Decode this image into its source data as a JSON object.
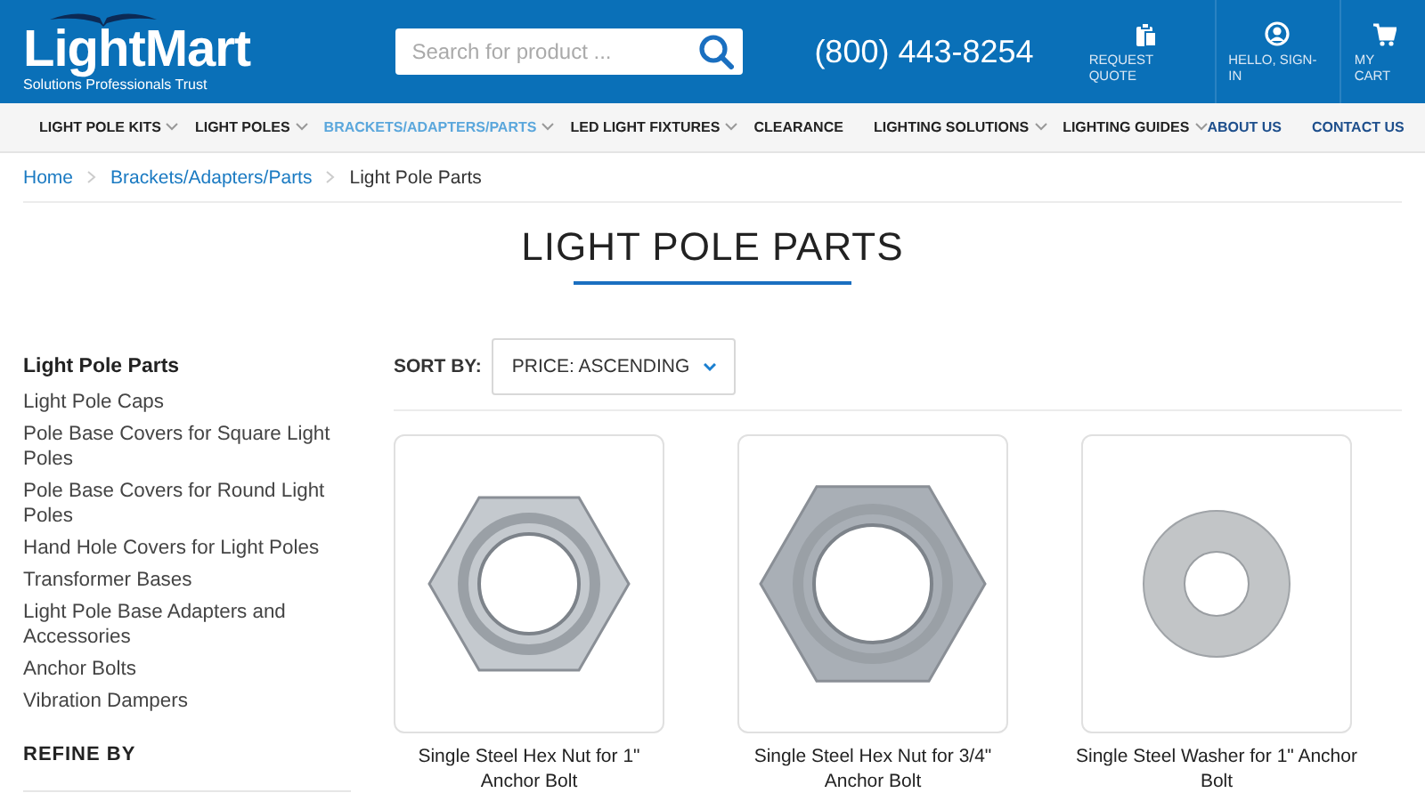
{
  "header": {
    "logo": "LightMart",
    "tagline": "Solutions Professionals Trust",
    "search": {
      "placeholder": "Search for product ..."
    },
    "phone": "(800) 443-8254",
    "actions": [
      {
        "kind": "quote",
        "label": "REQUEST QUOTE"
      },
      {
        "kind": "account",
        "label": "HELLO, SIGN-IN"
      },
      {
        "kind": "cart",
        "label": "MY CART"
      }
    ]
  },
  "nav": {
    "items": [
      {
        "label": "LIGHT POLE KITS",
        "has_menu": true,
        "selected": false
      },
      {
        "label": "LIGHT POLES",
        "has_menu": true,
        "selected": false
      },
      {
        "label": "BRACKETS/ADAPTERS/PARTS",
        "has_menu": true,
        "selected": true
      },
      {
        "label": "LED LIGHT FIXTURES",
        "has_menu": true,
        "selected": false
      },
      {
        "label": "CLEARANCE",
        "has_menu": false,
        "selected": false
      },
      {
        "label": "LIGHTING SOLUTIONS",
        "has_menu": true,
        "selected": false
      },
      {
        "label": "LIGHTING GUIDES",
        "has_menu": true,
        "selected": false
      }
    ],
    "right_links": [
      "ABOUT US",
      "CONTACT US"
    ]
  },
  "breadcrumb": [
    "Home",
    "Brackets/Adapters/Parts",
    "Light Pole Parts"
  ],
  "page_title": "LIGHT POLE PARTS",
  "sidebar": {
    "heading": "Light Pole Parts",
    "items": [
      "Light Pole Caps",
      "Pole Base Covers for Square Light Poles",
      "Pole Base Covers for Round Light Poles",
      "Hand Hole Covers for Light Poles",
      "Transformer Bases",
      "Light Pole Base Adapters and Accessories",
      "Anchor Bolts",
      "Vibration Dampers"
    ],
    "refine_heading": "REFINE BY"
  },
  "sort": {
    "label": "SORT BY:",
    "value": "PRICE: ASCENDING"
  },
  "products": [
    {
      "kind": "hex_nut",
      "title": "Single Steel Hex Nut for 1\" Anchor Bolt"
    },
    {
      "kind": "hex_nut_large",
      "title": "Single Steel Hex Nut for 3/4\" Anchor Bolt"
    },
    {
      "kind": "washer",
      "title": "Single Steel Washer for 1\" Anchor Bolt"
    }
  ]
}
